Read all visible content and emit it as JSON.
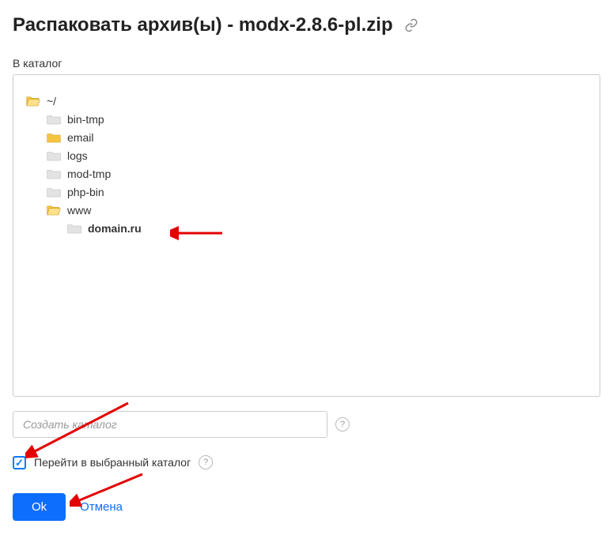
{
  "title": "Распаковать архив(ы) - modx-2.8.6-pl.zip",
  "label_catalog": "В каталог",
  "tree": {
    "root": "~/",
    "items": [
      {
        "name": "bin-tmp",
        "color": "gray"
      },
      {
        "name": "email",
        "color": "yellow"
      },
      {
        "name": "logs",
        "color": "gray"
      },
      {
        "name": "mod-tmp",
        "color": "gray"
      },
      {
        "name": "php-bin",
        "color": "gray"
      },
      {
        "name": "www",
        "color": "yellow-open",
        "children": [
          {
            "name": "domain.ru",
            "color": "gray",
            "bold": true
          }
        ]
      }
    ]
  },
  "create_placeholder": "Создать каталог",
  "checkbox_label": "Перейти в выбранный каталог",
  "checkbox_checked": true,
  "ok_label": "Ok",
  "cancel_label": "Отмена"
}
